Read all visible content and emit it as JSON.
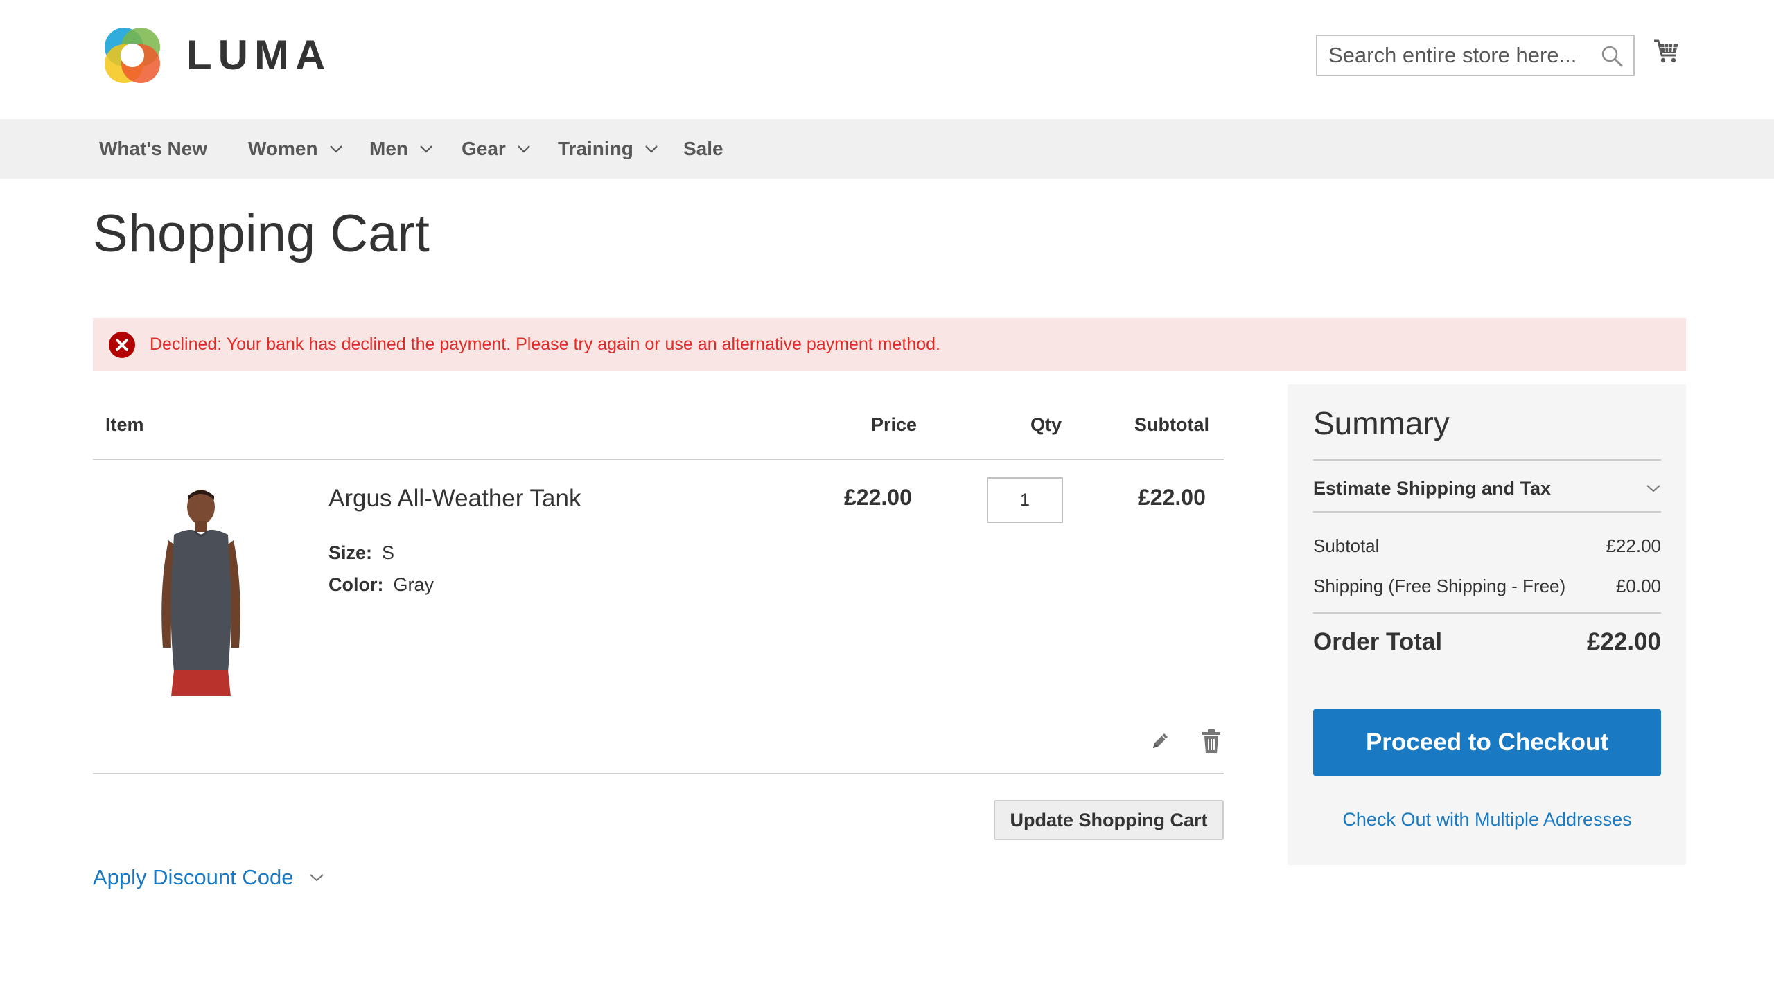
{
  "header": {
    "logo_text": "LUMA",
    "search": {
      "placeholder": "Search entire store here...",
      "value": ""
    },
    "icons": {
      "search": "search-icon",
      "cart": "cart-icon"
    }
  },
  "nav": {
    "items": [
      {
        "label": "What's New",
        "has_dropdown": false
      },
      {
        "label": "Women",
        "has_dropdown": true
      },
      {
        "label": "Men",
        "has_dropdown": true
      },
      {
        "label": "Gear",
        "has_dropdown": true
      },
      {
        "label": "Training",
        "has_dropdown": true
      },
      {
        "label": "Sale",
        "has_dropdown": false
      }
    ]
  },
  "page": {
    "title": "Shopping Cart"
  },
  "message": {
    "type": "error",
    "icon": "error-circle-icon",
    "text": "Declined: Your bank has declined the payment. Please try again or use an alternative payment method."
  },
  "cart": {
    "columns": {
      "item": "Item",
      "price": "Price",
      "qty": "Qty",
      "subtotal": "Subtotal"
    },
    "items": [
      {
        "name": "Argus All-Weather Tank",
        "options": [
          {
            "label": "Size:",
            "value": "S"
          },
          {
            "label": "Color:",
            "value": "Gray"
          }
        ],
        "price": "£22.00",
        "qty": "1",
        "subtotal": "£22.00"
      }
    ],
    "update_label": "Update Shopping Cart",
    "discount_label": "Apply Discount Code"
  },
  "summary": {
    "title": "Summary",
    "estimate_label": "Estimate Shipping and Tax",
    "rows": [
      {
        "label": "Subtotal",
        "value": "£22.00"
      },
      {
        "label": "Shipping (Free Shipping - Free)",
        "value": "£0.00"
      }
    ],
    "total": {
      "label": "Order Total",
      "value": "£22.00"
    },
    "checkout_label": "Proceed to Checkout",
    "multi_address_label": "Check Out with Multiple Addresses"
  },
  "colors": {
    "accent": "#1979c3",
    "error_bg": "#fae5e5",
    "error_text": "#e02b27",
    "nav_bg": "#f0f0f0",
    "summary_bg": "#f5f5f5"
  }
}
